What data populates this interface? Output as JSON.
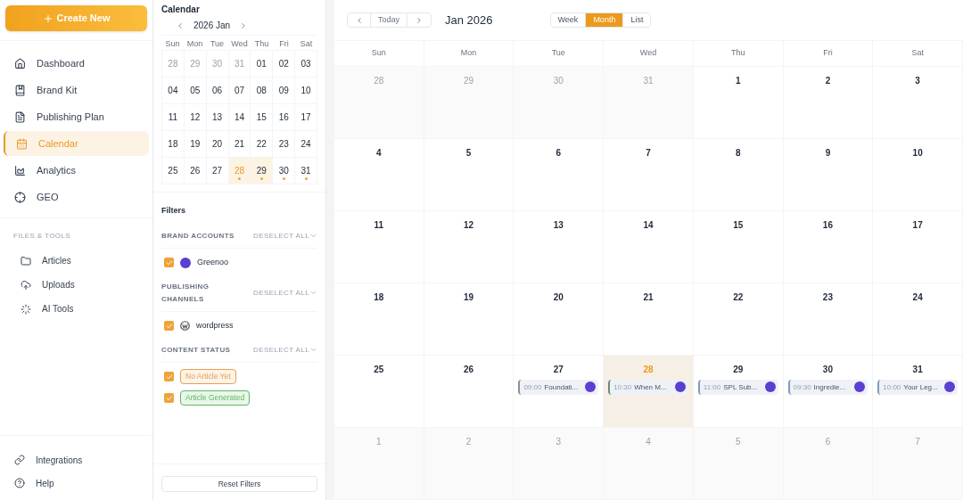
{
  "sidebar": {
    "create_button": {
      "label": "Create New"
    },
    "nav": [
      {
        "label": "Dashboard",
        "selected": false
      },
      {
        "label": "Brand Kit",
        "selected": false
      },
      {
        "label": "Publishing Plan",
        "selected": false
      },
      {
        "label": "Calendar",
        "selected": true
      },
      {
        "label": "Analytics",
        "selected": false
      },
      {
        "label": "GEO",
        "selected": false
      }
    ],
    "section_title": "FILES & TOOLS",
    "tools": [
      {
        "label": "Articles"
      },
      {
        "label": "Uploads"
      },
      {
        "label": "AI Tools"
      }
    ],
    "footer": [
      {
        "label": "Integrations"
      },
      {
        "label": "Help"
      }
    ]
  },
  "mini_calendar": {
    "title": "Calendar",
    "month": "2026 Jan",
    "weekdays": [
      "Sun",
      "Mon",
      "Tue",
      "Wed",
      "Thu",
      "Fri",
      "Sat"
    ],
    "weeks": [
      [
        {
          "label": "28",
          "muted": true,
          "today": false,
          "highlighted": false,
          "dot": false
        },
        {
          "label": "29",
          "muted": true,
          "today": false,
          "highlighted": false,
          "dot": false
        },
        {
          "label": "30",
          "muted": true,
          "today": false,
          "highlighted": false,
          "dot": false
        },
        {
          "label": "31",
          "muted": true,
          "today": false,
          "highlighted": false,
          "dot": false
        },
        {
          "label": "01",
          "muted": false,
          "today": false,
          "highlighted": false,
          "dot": false
        },
        {
          "label": "02",
          "muted": false,
          "today": false,
          "highlighted": false,
          "dot": false
        },
        {
          "label": "03",
          "muted": false,
          "today": false,
          "highlighted": false,
          "dot": false
        }
      ],
      [
        {
          "label": "04",
          "muted": false,
          "today": false,
          "highlighted": false,
          "dot": false
        },
        {
          "label": "05",
          "muted": false,
          "today": false,
          "highlighted": false,
          "dot": false
        },
        {
          "label": "06",
          "muted": false,
          "today": false,
          "highlighted": false,
          "dot": false
        },
        {
          "label": "07",
          "muted": false,
          "today": false,
          "highlighted": false,
          "dot": false
        },
        {
          "label": "08",
          "muted": false,
          "today": false,
          "highlighted": false,
          "dot": false
        },
        {
          "label": "09",
          "muted": false,
          "today": false,
          "highlighted": false,
          "dot": false
        },
        {
          "label": "10",
          "muted": false,
          "today": false,
          "highlighted": false,
          "dot": false
        }
      ],
      [
        {
          "label": "11",
          "muted": false,
          "today": false,
          "highlighted": false,
          "dot": false
        },
        {
          "label": "12",
          "muted": false,
          "today": false,
          "highlighted": false,
          "dot": false
        },
        {
          "label": "13",
          "muted": false,
          "today": false,
          "highlighted": false,
          "dot": false
        },
        {
          "label": "14",
          "muted": false,
          "today": false,
          "highlighted": false,
          "dot": false
        },
        {
          "label": "15",
          "muted": false,
          "today": false,
          "highlighted": false,
          "dot": false
        },
        {
          "label": "16",
          "muted": false,
          "today": false,
          "highlighted": false,
          "dot": false
        },
        {
          "label": "17",
          "muted": false,
          "today": false,
          "highlighted": false,
          "dot": false
        }
      ],
      [
        {
          "label": "18",
          "muted": false,
          "today": false,
          "highlighted": false,
          "dot": false
        },
        {
          "label": "19",
          "muted": false,
          "today": false,
          "highlighted": false,
          "dot": false
        },
        {
          "label": "20",
          "muted": false,
          "today": false,
          "highlighted": false,
          "dot": false
        },
        {
          "label": "21",
          "muted": false,
          "today": false,
          "highlighted": false,
          "dot": false
        },
        {
          "label": "22",
          "muted": false,
          "today": false,
          "highlighted": false,
          "dot": false
        },
        {
          "label": "23",
          "muted": false,
          "today": false,
          "highlighted": false,
          "dot": false
        },
        {
          "label": "24",
          "muted": false,
          "today": false,
          "highlighted": false,
          "dot": false
        }
      ],
      [
        {
          "label": "25",
          "muted": false,
          "today": false,
          "highlighted": false,
          "dot": false
        },
        {
          "label": "26",
          "muted": false,
          "today": false,
          "highlighted": false,
          "dot": false
        },
        {
          "label": "27",
          "muted": false,
          "today": false,
          "highlighted": false,
          "dot": false
        },
        {
          "label": "28",
          "muted": false,
          "today": true,
          "highlighted": true,
          "dot": true
        },
        {
          "label": "29",
          "muted": false,
          "today": false,
          "highlighted": true,
          "dot": true
        },
        {
          "label": "30",
          "muted": false,
          "today": false,
          "highlighted": false,
          "dot": true
        },
        {
          "label": "31",
          "muted": false,
          "today": false,
          "highlighted": false,
          "dot": true
        }
      ]
    ]
  },
  "filters": {
    "title": "Filters",
    "groups": [
      {
        "label": "BRAND ACCOUNTS",
        "action": "DESELECT ALL",
        "options": [
          {
            "kind": "account",
            "label": "Greenoo",
            "checked": true
          }
        ]
      },
      {
        "label": "PUBLISHING CHANNELS",
        "action": "DESELECT ALL",
        "options": [
          {
            "kind": "channel",
            "label": "wordpress",
            "checked": true
          }
        ]
      },
      {
        "label": "CONTENT STATUS",
        "action": "DESELECT ALL",
        "options": [
          {
            "kind": "status",
            "label": "No Article Yet",
            "checked": true,
            "color": "#e9a04e"
          },
          {
            "kind": "status",
            "label": "Article Generated",
            "checked": true,
            "color": "#5cb85c"
          }
        ]
      }
    ],
    "reset_button": "Reset Filters"
  },
  "toolbar": {
    "today": "Today",
    "title": "Jan 2026",
    "views": [
      {
        "label": "Week",
        "selected": false
      },
      {
        "label": "Month",
        "selected": true
      },
      {
        "label": "List",
        "selected": false
      }
    ]
  },
  "weekdays": [
    "Sun",
    "Mon",
    "Tue",
    "Wed",
    "Thu",
    "Fri",
    "Sat"
  ],
  "weeks": [
    [
      {
        "label": "28",
        "muted": true,
        "today": false
      },
      {
        "label": "29",
        "muted": true,
        "today": false
      },
      {
        "label": "30",
        "muted": true,
        "today": false
      },
      {
        "label": "31",
        "muted": true,
        "today": false
      },
      {
        "label": "1",
        "muted": false,
        "today": false
      },
      {
        "label": "2",
        "muted": false,
        "today": false
      },
      {
        "label": "3",
        "muted": false,
        "today": false
      }
    ],
    [
      {
        "label": "4",
        "muted": false,
        "today": false
      },
      {
        "label": "5",
        "muted": false,
        "today": false
      },
      {
        "label": "6",
        "muted": false,
        "today": false
      },
      {
        "label": "7",
        "muted": false,
        "today": false
      },
      {
        "label": "8",
        "muted": false,
        "today": false
      },
      {
        "label": "9",
        "muted": false,
        "today": false
      },
      {
        "label": "10",
        "muted": false,
        "today": false
      }
    ],
    [
      {
        "label": "11",
        "muted": false,
        "today": false
      },
      {
        "label": "12",
        "muted": false,
        "today": false
      },
      {
        "label": "13",
        "muted": false,
        "today": false
      },
      {
        "label": "14",
        "muted": false,
        "today": false
      },
      {
        "label": "15",
        "muted": false,
        "today": false
      },
      {
        "label": "16",
        "muted": false,
        "today": false
      },
      {
        "label": "17",
        "muted": false,
        "today": false
      }
    ],
    [
      {
        "label": "18",
        "muted": false,
        "today": false
      },
      {
        "label": "19",
        "muted": false,
        "today": false
      },
      {
        "label": "20",
        "muted": false,
        "today": false
      },
      {
        "label": "21",
        "muted": false,
        "today": false
      },
      {
        "label": "22",
        "muted": false,
        "today": false
      },
      {
        "label": "23",
        "muted": false,
        "today": false
      },
      {
        "label": "24",
        "muted": false,
        "today": false
      }
    ],
    [
      {
        "label": "25",
        "muted": false,
        "today": false
      },
      {
        "label": "26",
        "muted": false,
        "today": false
      },
      {
        "label": "27",
        "muted": false,
        "today": false,
        "events": [
          {
            "time": "09:00",
            "title": "Foundati...",
            "color": "#8a8f98"
          }
        ]
      },
      {
        "label": "28",
        "muted": false,
        "today": true,
        "events": [
          {
            "time": "10:30",
            "title": "When M...",
            "color": "#6e8a78"
          }
        ]
      },
      {
        "label": "29",
        "muted": false,
        "today": false,
        "events": [
          {
            "time": "11:00",
            "title": "SPL Sub...",
            "color": "#7f9bbd"
          }
        ]
      },
      {
        "label": "30",
        "muted": false,
        "today": false,
        "events": [
          {
            "time": "09:30",
            "title": "Ingredie...",
            "color": "#7f9bbd"
          }
        ]
      },
      {
        "label": "31",
        "muted": false,
        "today": false,
        "events": [
          {
            "time": "10:00",
            "title": "Your Leg...",
            "color": "#7f9bbd"
          }
        ]
      }
    ],
    [
      {
        "label": "1",
        "muted": true,
        "today": false
      },
      {
        "label": "2",
        "muted": true,
        "today": false
      },
      {
        "label": "3",
        "muted": true,
        "today": false
      },
      {
        "label": "4",
        "muted": true,
        "today": false
      },
      {
        "label": "5",
        "muted": true,
        "today": false
      },
      {
        "label": "6",
        "muted": true,
        "today": false
      },
      {
        "label": "7",
        "muted": true,
        "today": false
      }
    ]
  ]
}
